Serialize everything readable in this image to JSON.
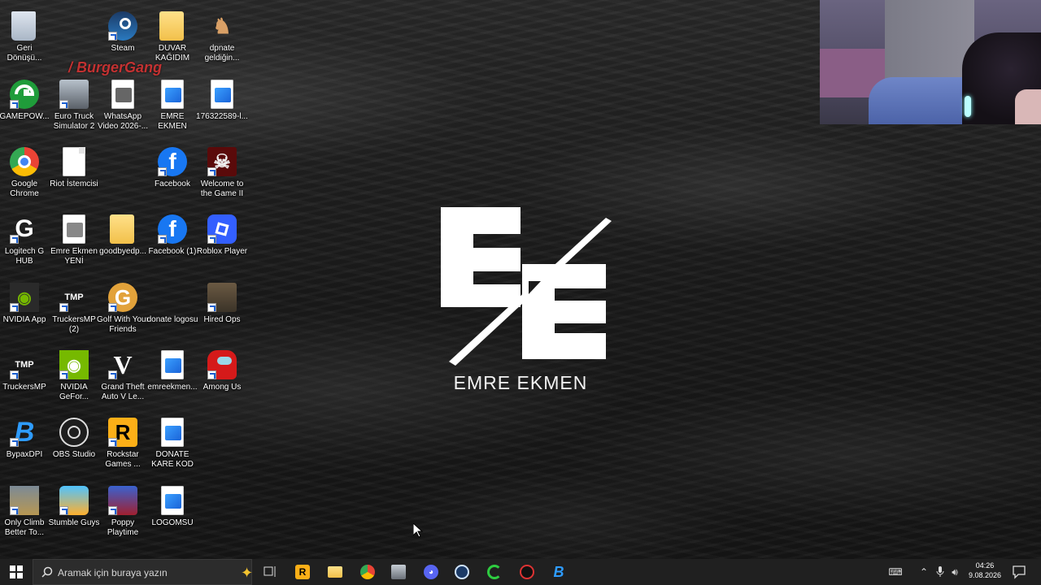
{
  "wallpaper": {
    "logo_text": "EMRE EKMEN",
    "colors": {
      "background": "#1b1b1b",
      "logo": "#ffffff"
    }
  },
  "webcam": {
    "label": "webcam overlay"
  },
  "desktop": {
    "icons": [
      {
        "label": "Geri Dönüşü...",
        "icon": "recycle-bin"
      },
      {
        "label": "Steam",
        "icon": "steam"
      },
      {
        "label": "DUVAR KAĞIDIM",
        "icon": "folder"
      },
      {
        "label": "dpnate geldiğin...",
        "icon": "figure"
      },
      {
        "label": "GAMEPOW...",
        "icon": "gamepower"
      },
      {
        "label": "Euro Truck Simulator 2",
        "icon": "ets2"
      },
      {
        "label": "WhatsApp Video 2026-...",
        "icon": "video-file"
      },
      {
        "label": "EMRE EKMEN",
        "icon": "image-file"
      },
      {
        "label": "176322589-l...",
        "icon": "image-file"
      },
      {
        "label": "Google Chrome",
        "icon": "chrome"
      },
      {
        "label": "Riot İstemcisi",
        "icon": "blank-file"
      },
      {
        "label": "Facebook",
        "icon": "facebook"
      },
      {
        "label": "Welcome to the Game II",
        "icon": "skull"
      },
      {
        "label": "Logitech G HUB",
        "icon": "logitech"
      },
      {
        "label": "Emre Ekmen YENİ",
        "icon": "video-file"
      },
      {
        "label": "goodbyedp...",
        "icon": "folder-zip"
      },
      {
        "label": "Facebook (1)",
        "icon": "facebook"
      },
      {
        "label": "Roblox Player",
        "icon": "roblox"
      },
      {
        "label": "NVIDIA App",
        "icon": "nvidia"
      },
      {
        "label": "TruckersMP (2)",
        "icon": "truckersmp"
      },
      {
        "label": "Golf With Your Friends",
        "icon": "golf"
      },
      {
        "label": "donate logosu",
        "icon": "none"
      },
      {
        "label": "Hired Ops",
        "icon": "hiredops"
      },
      {
        "label": "TruckersMP",
        "icon": "truckersmp"
      },
      {
        "label": "NVIDIA GeFor...",
        "icon": "nvidia"
      },
      {
        "label": "Grand Theft Auto V Le...",
        "icon": "gta"
      },
      {
        "label": "emreekmen...",
        "icon": "image-file"
      },
      {
        "label": "Among Us",
        "icon": "amongus"
      },
      {
        "label": "BypaxDPI",
        "icon": "bypax"
      },
      {
        "label": "OBS Studio",
        "icon": "obs"
      },
      {
        "label": "Rockstar Games ...",
        "icon": "rockstar"
      },
      {
        "label": "DONATE KARE KOD",
        "icon": "image-file"
      },
      {
        "label": "Only Climb Better To...",
        "icon": "onlyclimb"
      },
      {
        "label": "Stumble Guys",
        "icon": "stumble"
      },
      {
        "label": "Poppy Playtime",
        "icon": "poppy"
      },
      {
        "label": "LOGOMSU",
        "icon": "image-file"
      }
    ],
    "overlay_text": "/ BurgerGang"
  },
  "taskbar": {
    "search_placeholder": "Aramak için buraya yazın",
    "pinned": [
      "task-view",
      "rockstar",
      "file-explorer",
      "chrome",
      "ets2",
      "discord",
      "steam",
      "gamepower",
      "app-red",
      "bypax"
    ],
    "clock": {
      "time": "04:26",
      "date": "9.08.2026"
    }
  }
}
